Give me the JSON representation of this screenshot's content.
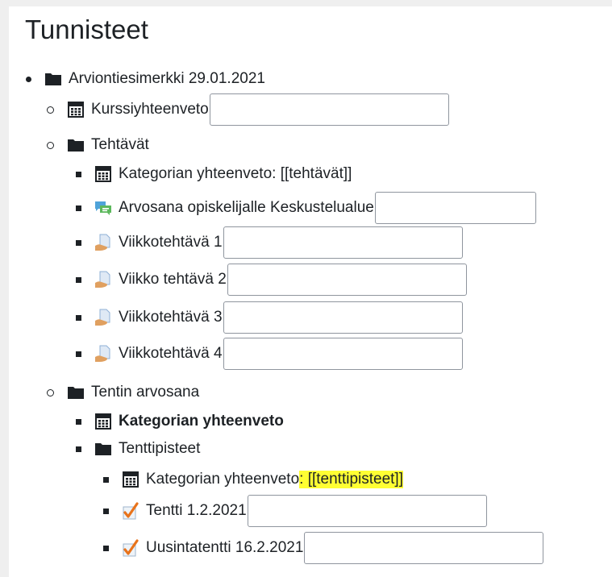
{
  "page": {
    "title": "Tunnisteet"
  },
  "tree": {
    "root": {
      "label": "Arviontiesimerkki 29.01.2021",
      "icon": "folder-icon"
    },
    "course_total": {
      "label": "Kurssiyhteenveto",
      "icon": "calculator-icon",
      "value": ""
    },
    "tasks": {
      "label": "Tehtävät",
      "icon": "folder-icon"
    },
    "tasks_total": {
      "label": "Kategorian yhteenveto: [[tehtävät]]",
      "icon": "calculator-icon"
    },
    "forum_grade": {
      "label": "Arvosana opiskelijalle Keskustelualue",
      "icon": "forum-icon",
      "value": ""
    },
    "week1": {
      "label": "Viikkotehtävä 1",
      "icon": "assignment-icon",
      "value": ""
    },
    "week2": {
      "label": "Viikko tehtävä 2",
      "icon": "assignment-icon",
      "value": ""
    },
    "week3": {
      "label": "Viikkotehtävä 3",
      "icon": "assignment-icon",
      "value": ""
    },
    "week4": {
      "label": "Viikkotehtävä 4",
      "icon": "assignment-icon",
      "value": ""
    },
    "exam_grade": {
      "label": "Tentin arvosana",
      "icon": "folder-icon"
    },
    "exam_total": {
      "label": "Kategorian yhteenveto",
      "icon": "calculator-icon"
    },
    "exam_points": {
      "label": "Tenttipisteet",
      "icon": "folder-icon"
    },
    "exam_points_total": {
      "label_prefix": "Kategorian yhteenveto",
      "label_colon": ":",
      "label_tag": " [[tenttipisteet]]",
      "highlight_color": "#ffff33",
      "icon": "calculator-icon"
    },
    "exam1": {
      "label": "Tentti 1.2.2021",
      "icon": "quiz-icon",
      "value": ""
    },
    "retake": {
      "label": "Uusintatentti 16.2.2021",
      "icon": "quiz-icon",
      "value": ""
    }
  },
  "colors": {
    "text": "#1d2125",
    "quiz_check": "#e8731b",
    "forum_green": "#5cb85c",
    "forum_blue": "#4fa3d9"
  }
}
